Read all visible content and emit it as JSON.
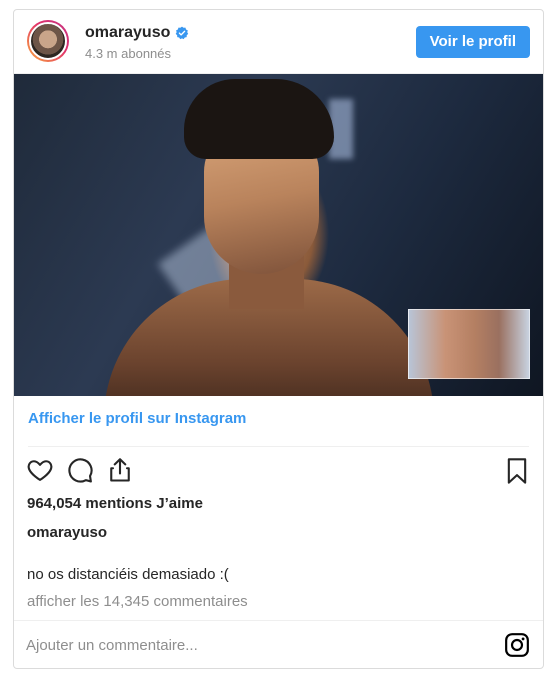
{
  "header": {
    "username": "omarayuso",
    "subscribers": "4.3 m abonnés",
    "view_profile_label": "Voir le profil",
    "verified_icon": "verified-badge-icon"
  },
  "post": {
    "profile_link": "Afficher le profil sur Instagram",
    "likes": "964,054 mentions J’aime",
    "owner": "omarayuso",
    "caption": "no os distanciéis demasiado :(",
    "view_comments": "afficher les 14,345 commentaires"
  },
  "actions": {
    "icons": [
      "heart-icon",
      "comment-icon",
      "share-icon",
      "bookmark-icon"
    ]
  },
  "footer": {
    "comment_placeholder": "Ajouter un commentaire...",
    "brand_icon": "instagram-icon"
  },
  "colors": {
    "accent": "#3897f0",
    "text": "#262626",
    "muted": "#8e8e8e",
    "border": "#dbdbdb"
  }
}
